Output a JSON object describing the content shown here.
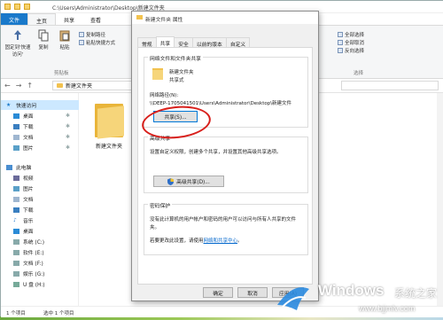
{
  "explorer": {
    "title_path": "C:\\Users\\Administrator\\Desktop\\新建文件夹",
    "ribbon_tabs": [
      "文件",
      "主页",
      "共享",
      "查看"
    ],
    "ribbon": {
      "pin_label": "固定到'快速访问'",
      "copy_label": "复制",
      "paste_label": "粘贴",
      "copy_path": "复制路径",
      "paste_shortcut": "粘贴快捷方式",
      "clipboard_group": "剪贴板",
      "select_all": "全部选择",
      "select_none": "全部取消",
      "invert_selection": "反向选择",
      "select_group": "选择"
    },
    "address": "新建文件夹",
    "nav": {
      "quick_access": "快速访问",
      "items": [
        "桌面",
        "下载",
        "文档",
        "图片"
      ],
      "this_pc": "此电脑",
      "pc_items": [
        "视频",
        "图片",
        "文档",
        "下载",
        "音乐",
        "桌面"
      ],
      "drives": [
        "系统 (C:)",
        "软件 (E:)",
        "文档 (F:)",
        "娱乐 (G:)",
        "U 盘 (H:)"
      ]
    },
    "folder_label": "新建文件夹",
    "status": {
      "count": "1 个项目",
      "selected": "选中 1 个项目"
    }
  },
  "dialog": {
    "title": "新建文件夹 属性",
    "tabs": [
      "常规",
      "共享",
      "安全",
      "以前的版本",
      "自定义"
    ],
    "active_tab": "共享",
    "net_sharing": {
      "group_label": "网络文件和文件夹共享",
      "folder_name": "新建文件夹",
      "share_state": "共享式",
      "path_label": "网络路径(N):",
      "path_value": "\\\\DEEP-1705041501\\Users\\Administrator\\Desktop\\新建文件",
      "share_button": "共享(S)..."
    },
    "advanced": {
      "group_label": "高级共享",
      "desc_line1": "设置自定义权限，创建多个共享，并设置其他高级共享选项。",
      "button": "高级共享(D)..."
    },
    "password": {
      "group_label": "密码保护",
      "desc_line1": "没有此计算机的用户帐户和密码的用户可以访问与所有人共享的文件",
      "desc_line2": "夹。",
      "change_text": "若要更改此设置，请使用",
      "change_link": "网络和共享中心",
      "change_end": "。"
    },
    "footer": {
      "ok": "确定",
      "cancel": "取消",
      "apply": "应用(A)"
    }
  },
  "watermark": {
    "brand": "Windows",
    "cn": "系统之家",
    "url": "www.bjjmlv.com"
  },
  "colors": {
    "file_tab": "#1979ca",
    "selection": "#cce8ff",
    "folder": "#f2c24f",
    "highlight_ring": "#d8201c",
    "link": "#0066cc"
  }
}
